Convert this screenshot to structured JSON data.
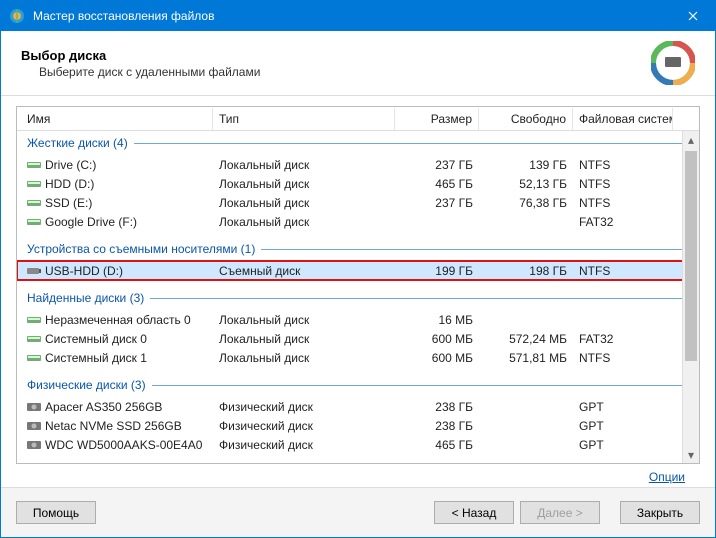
{
  "window": {
    "title": "Мастер восстановления файлов"
  },
  "header": {
    "title": "Выбор диска",
    "subtitle": "Выберите диск с удаленными файлами"
  },
  "columns": {
    "name": "Имя",
    "type": "Тип",
    "size": "Размер",
    "free": "Свободно",
    "fs": "Файловая система"
  },
  "groups": [
    {
      "label": "Жесткие диски (4)",
      "rows": [
        {
          "icon": "hdd",
          "name": "Drive (C:)",
          "type": "Локальный диск",
          "size": "237 ГБ",
          "free": "139 ГБ",
          "fs": "NTFS"
        },
        {
          "icon": "hdd",
          "name": "HDD (D:)",
          "type": "Локальный диск",
          "size": "465 ГБ",
          "free": "52,13 ГБ",
          "fs": "NTFS"
        },
        {
          "icon": "hdd",
          "name": "SSD (E:)",
          "type": "Локальный диск",
          "size": "237 ГБ",
          "free": "76,38 ГБ",
          "fs": "NTFS"
        },
        {
          "icon": "hdd",
          "name": "Google Drive (F:)",
          "type": "Локальный диск",
          "size": "",
          "free": "",
          "fs": "FAT32"
        }
      ]
    },
    {
      "label": "Устройства со съемными носителями (1)",
      "rows": [
        {
          "icon": "usb",
          "name": "USB-HDD (D:)",
          "type": "Съемный диск",
          "size": "199 ГБ",
          "free": "198 ГБ",
          "fs": "NTFS",
          "selected": true,
          "highlight": true
        }
      ]
    },
    {
      "label": "Найденные диски (3)",
      "rows": [
        {
          "icon": "hdd",
          "name": "Неразмеченная область 0",
          "type": "Локальный диск",
          "size": "16 МБ",
          "free": "",
          "fs": ""
        },
        {
          "icon": "hdd",
          "name": "Системный диск 0",
          "type": "Локальный диск",
          "size": "600 МБ",
          "free": "572,24 МБ",
          "fs": "FAT32"
        },
        {
          "icon": "hdd",
          "name": "Системный диск 1",
          "type": "Локальный диск",
          "size": "600 МБ",
          "free": "571,81 МБ",
          "fs": "NTFS"
        }
      ]
    },
    {
      "label": "Физические диски (3)",
      "rows": [
        {
          "icon": "phys",
          "name": "Apacer AS350 256GB",
          "type": "Физический диск",
          "size": "238 ГБ",
          "free": "",
          "fs": "GPT"
        },
        {
          "icon": "phys",
          "name": "Netac NVMe SSD 256GB",
          "type": "Физический диск",
          "size": "238 ГБ",
          "free": "",
          "fs": "GPT"
        },
        {
          "icon": "phys",
          "name": "WDC WD5000AAKS-00E4A0",
          "type": "Физический диск",
          "size": "465 ГБ",
          "free": "",
          "fs": "GPT"
        }
      ]
    }
  ],
  "options_link": "Опции",
  "footer": {
    "help": "Помощь",
    "back": "< Назад",
    "next": "Далее >",
    "close": "Закрыть"
  }
}
